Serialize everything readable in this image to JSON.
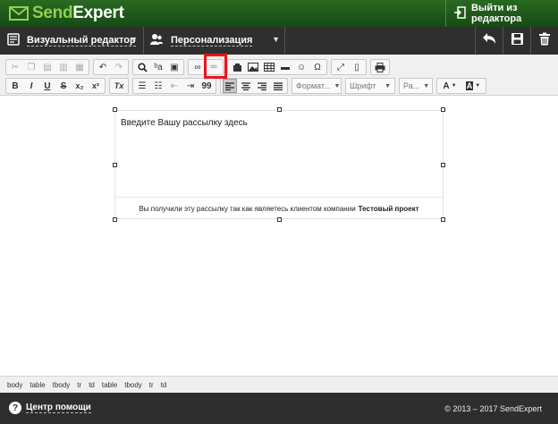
{
  "header": {
    "logo_part1": "Send",
    "logo_part2": "Expert",
    "exit_label": "Выйти из редактора"
  },
  "nav": {
    "visual_editor_label": "Визуальный редактор",
    "personalization_label": "Персонализация"
  },
  "toolbar": {
    "bold": "B",
    "italic": "I",
    "underline": "U",
    "strike": "S",
    "subscript": "x₂",
    "superscript": "x²",
    "clear_format": "Tx",
    "quote": "99",
    "omega": "Ω",
    "format_label": "Формат...",
    "font_label": "Шрифт",
    "size_label": "Ра...",
    "text_color_label": "A",
    "bg_color_label": "A"
  },
  "editor": {
    "placeholder_text": "Введите Вашу рассылку здесь",
    "footer_text": "Вы получили эту рассылку так как являетесь клиентом компании",
    "footer_company": "Тестовый проект"
  },
  "statusbar": {
    "path": [
      "body",
      "table",
      "tbody",
      "tr",
      "td",
      "table",
      "tbody",
      "tr",
      "td"
    ]
  },
  "footer": {
    "help_label": "Центр помощи",
    "copyright": "© 2013 – 2017 SendExpert"
  },
  "colors": {
    "header_green": "#1f5a1f",
    "logo_accent": "#8fd14f",
    "nav_dark": "#2f2f2f",
    "highlight_red": "#e8141a"
  }
}
